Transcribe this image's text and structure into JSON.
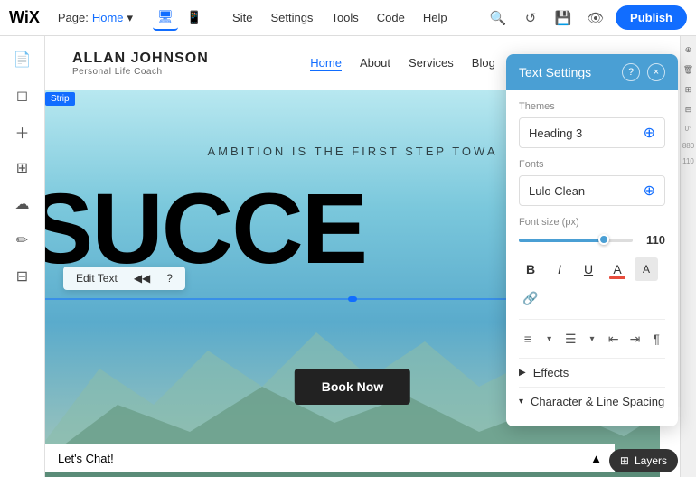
{
  "topbar": {
    "logo": "WiX",
    "page_label": "Page:",
    "page_name": "Home",
    "chevron": "▾",
    "nav_items": [
      "Site",
      "Settings",
      "Tools",
      "Code",
      "Help"
    ],
    "publish_label": "Publish",
    "device_desktop": "🖥",
    "device_mobile": "📱"
  },
  "site_header": {
    "logo_name": "ALLAN JOHNSON",
    "logo_subtitle": "Personal Life Coach",
    "nav_items": [
      "Home",
      "About",
      "Services",
      "Blog"
    ],
    "active_nav": "Home"
  },
  "hero": {
    "strip_label": "Strip",
    "subtitle": "AMBITION IS THE FIRST STEP TOWA",
    "title": "SUCCE",
    "cta_label": "Book Now"
  },
  "edit_toolbar": {
    "edit_text": "Edit Text",
    "arrow_left": "◀◀",
    "help": "?"
  },
  "text_settings": {
    "panel_title": "Text Settings",
    "help_icon": "?",
    "close_icon": "×",
    "themes_label": "Themes",
    "themes_value": "Heading 3",
    "fonts_label": "Fonts",
    "fonts_value": "Lulo Clean",
    "font_size_label": "Font size (px)",
    "font_size_value": "110",
    "slider_fill_percent": 72,
    "format_buttons": [
      {
        "id": "bold",
        "label": "B",
        "style": "bold"
      },
      {
        "id": "italic",
        "label": "I",
        "style": "italic"
      },
      {
        "id": "underline",
        "label": "U",
        "style": "underline"
      },
      {
        "id": "font-color",
        "label": "A"
      },
      {
        "id": "highlight",
        "label": "A"
      },
      {
        "id": "link",
        "label": "🔗"
      }
    ],
    "align_buttons": [
      {
        "id": "align-left",
        "label": "≡"
      },
      {
        "id": "align-chevron",
        "label": "▾"
      },
      {
        "id": "list",
        "label": "☰"
      },
      {
        "id": "list-chevron",
        "label": "▾"
      },
      {
        "id": "indent-left",
        "label": "⇤"
      },
      {
        "id": "indent-right",
        "label": "⇥"
      },
      {
        "id": "paragraph",
        "label": "¶"
      }
    ],
    "effects_label": "Effects",
    "effects_arrow": "▶",
    "char_spacing_label": "Character & Line Spacing",
    "char_spacing_arrow": "▾"
  },
  "bottom_bar": {
    "chat_label": "Let's Chat!",
    "chat_arrow": "▲",
    "layers_label": "Layers",
    "layers_icon": "⊞"
  },
  "right_panel_small": {
    "icons": [
      "⊕",
      "🗑",
      "⊞",
      "⊟",
      "?",
      "?"
    ]
  }
}
